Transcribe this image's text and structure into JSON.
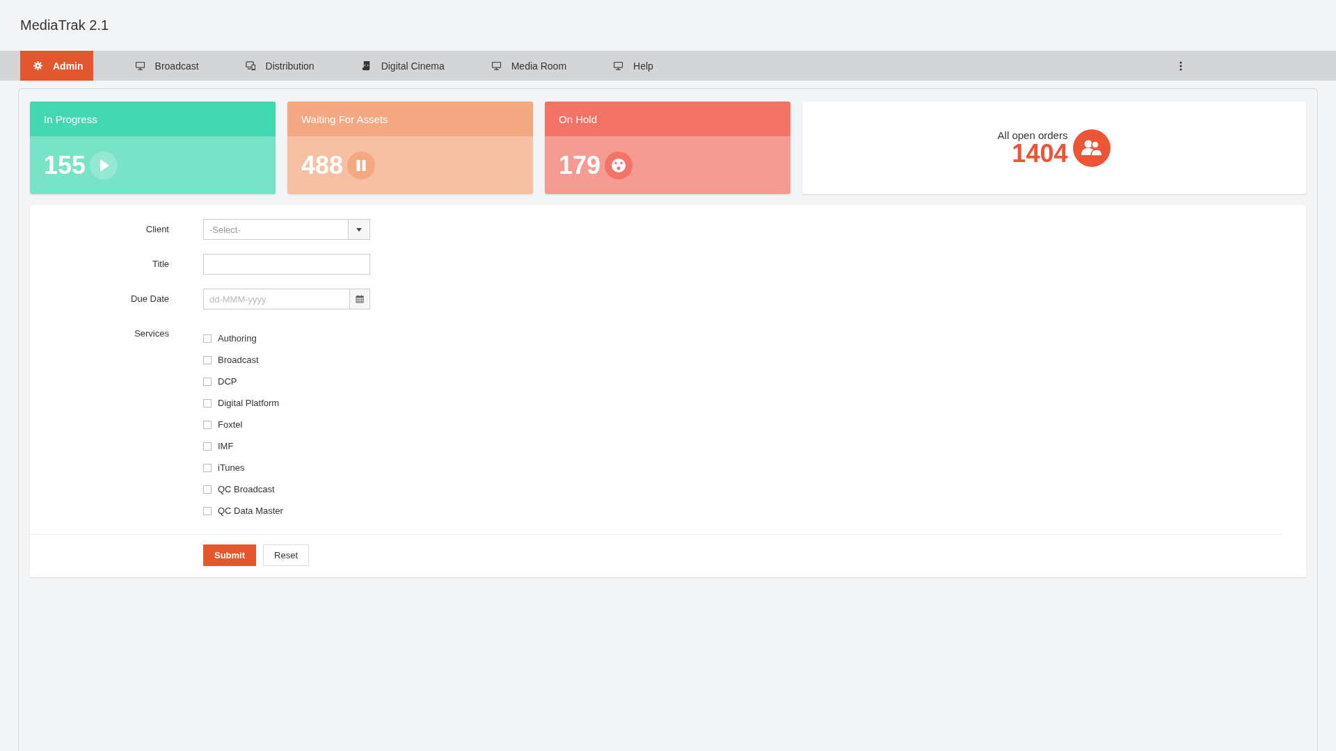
{
  "app": {
    "title": "MediaTrak 2.1"
  },
  "nav": {
    "tabs": [
      {
        "label": "Admin",
        "kind": "gear",
        "selected": true
      },
      {
        "label": "Broadcast",
        "kind": "monitor",
        "selected": false
      },
      {
        "label": "Distribution",
        "kind": "devices",
        "selected": false
      },
      {
        "label": "Digital Cinema",
        "kind": "scroll",
        "selected": false
      },
      {
        "label": "Media Room",
        "kind": "monitor",
        "selected": false
      },
      {
        "label": "Help",
        "kind": "monitor",
        "selected": false
      }
    ]
  },
  "status_cards": [
    {
      "title": "In Progress",
      "count": "155",
      "kind": "play",
      "color": "#43d8b0"
    },
    {
      "title": "Waiting For Assets",
      "count": "488",
      "kind": "pause",
      "color": "#f4a882"
    },
    {
      "title": "On Hold",
      "count": "179",
      "kind": "dizzy",
      "color": "#f37467"
    }
  ],
  "total_card": {
    "label": "All open orders",
    "count": "1404"
  },
  "form": {
    "fields": [
      {
        "label": "Client",
        "kind": "select",
        "value": "-Select-"
      },
      {
        "label": "Title",
        "kind": "text"
      },
      {
        "label": "Due Date",
        "kind": "date",
        "placeholder": "dd-MMM-yyyy"
      }
    ],
    "services": {
      "label": "Services",
      "options": [
        {
          "label": "Authoring",
          "checked": false
        },
        {
          "label": "Broadcast",
          "checked": false
        },
        {
          "label": "DCP",
          "checked": false
        },
        {
          "label": "Digital Platform",
          "checked": false
        },
        {
          "label": "Foxtel",
          "checked": false
        },
        {
          "label": "IMF",
          "checked": false
        },
        {
          "label": "iTunes",
          "checked": false
        },
        {
          "label": "QC Broadcast",
          "checked": false
        },
        {
          "label": "QC Data Master",
          "checked": false
        }
      ]
    },
    "buttons": [
      {
        "label": "Submit",
        "kind": "primary"
      },
      {
        "label": "Reset",
        "kind": "default"
      }
    ]
  }
}
